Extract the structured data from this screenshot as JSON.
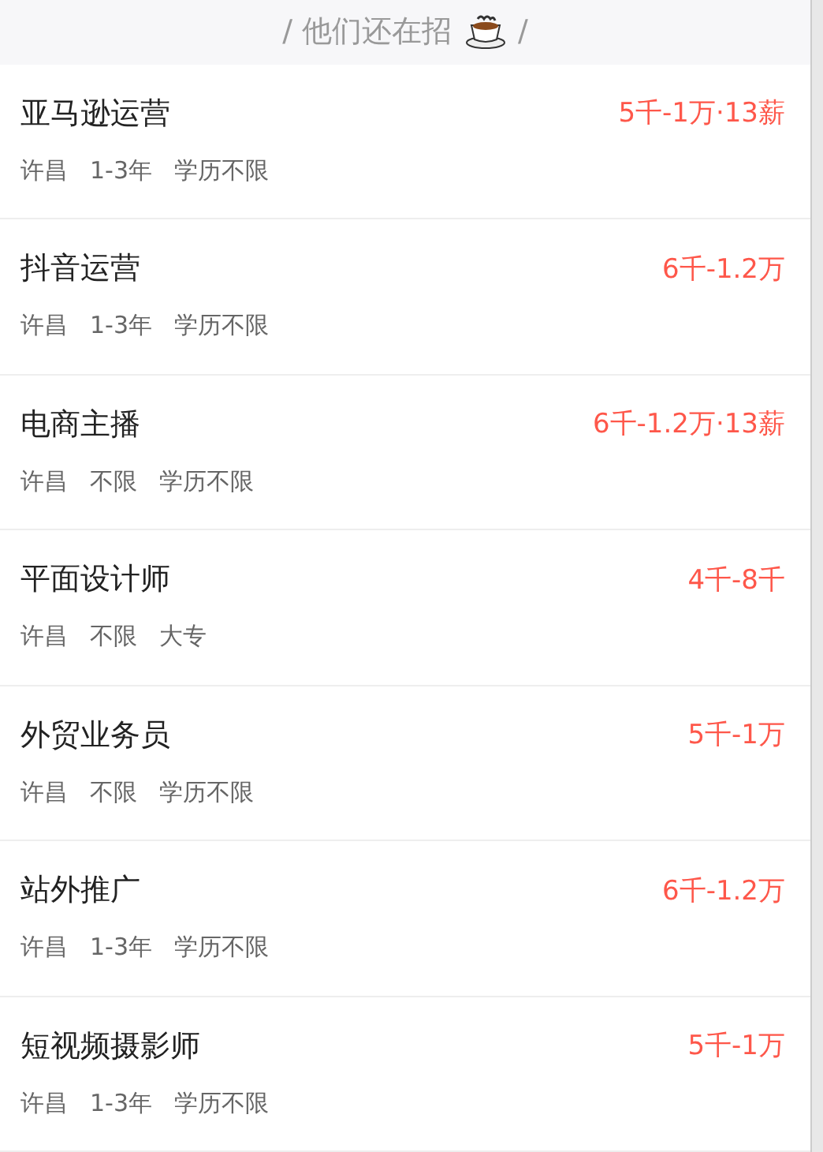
{
  "header": {
    "title": "/ 他们还在招",
    "suffix": "/"
  },
  "jobs": [
    {
      "title": "亚马逊运营",
      "salary": "5千-1万·13薪",
      "tags": [
        "许昌",
        "1-3年",
        "学历不限"
      ]
    },
    {
      "title": "抖音运营",
      "salary": "6千-1.2万",
      "tags": [
        "许昌",
        "1-3年",
        "学历不限"
      ]
    },
    {
      "title": "电商主播",
      "salary": "6千-1.2万·13薪",
      "tags": [
        "许昌",
        "不限",
        "学历不限"
      ]
    },
    {
      "title": "平面设计师",
      "salary": "4千-8千",
      "tags": [
        "许昌",
        "不限",
        "大专"
      ]
    },
    {
      "title": "外贸业务员",
      "salary": "5千-1万",
      "tags": [
        "许昌",
        "不限",
        "学历不限"
      ]
    },
    {
      "title": "站外推广",
      "salary": "6千-1.2万",
      "tags": [
        "许昌",
        "1-3年",
        "学历不限"
      ]
    },
    {
      "title": "短视频摄影师",
      "salary": "5千-1万",
      "tags": [
        "许昌",
        "1-3年",
        "学历不限"
      ]
    }
  ]
}
